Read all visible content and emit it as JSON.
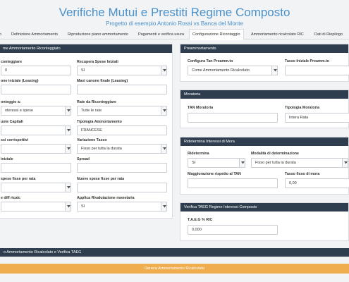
{
  "header": {
    "title": "Verifiche Mutui e Prestiti Regime Composto",
    "subtitle": "Progetto di esempio Antonio Rossi vs Banca del Monte"
  },
  "tabs": [
    {
      "label": "o"
    },
    {
      "label": "Definizione Ammortamento"
    },
    {
      "label": "Riproduzione piano ammortamento"
    },
    {
      "label": "Pagamenti e verifica usura"
    },
    {
      "label": "Configurazione Ricontaggio"
    },
    {
      "label": "Ammortamento ricalcolato RIC"
    },
    {
      "label": "Dati di Riepilogo"
    }
  ],
  "left_panel": {
    "title": "me Ammortamento Riconteggiato",
    "fields": {
      "ricont_label": "conteggiare",
      "ricont_value": "0",
      "recupera_label": "Recupera Spese Iniziali",
      "recupera_value": "SI",
      "canone_iniziale_label": "one iniziale (Leasing)",
      "maxi_canone_label": "Maxi canone finale (Leasing)",
      "ricont_a_label": "onteggio a:",
      "ricont_a_value": "nteressi e spese",
      "rate_ricont_label": "Rate da Riconteggiare",
      "rate_ricont_value": "Tutte le rate",
      "quote_capitali_label": "uote Capitali",
      "tipologia_amm_label": "Tipologia Ammortamento",
      "tipologia_amm_value": "FRANCESE",
      "tassi_label": "ssi corrispettivi",
      "variazione_label": "Variazione Tasso",
      "variazione_value": "Fisso per tutta la durata",
      "iniziale_label": "iniziale",
      "spread_label": "Spread",
      "spese_rata_label": "spese fisse per rata",
      "nuove_spese_label": "Nuove spese fisse per rata",
      "diff_label": "e diff ricalc",
      "rivalutazione_label": "Applica Rivalutazione monetaria",
      "rivalutazione_value": "SI"
    }
  },
  "preammortamento": {
    "title": "Preammortamento",
    "config_label": "Configura Tan Preamm.to",
    "config_value": "Come Ammortamento Ricalcolato",
    "tasso_label": "Tasso Iniziale Preamm.to"
  },
  "moratoria": {
    "title": "Moratoria",
    "tan_label": "TAN Moratoria",
    "tipologia_label": "Tipologia Moratoria",
    "tipologia_value": "Intera Rata"
  },
  "ridetermina": {
    "title": "Ridetermina Interessi di Mora",
    "ridetermina_label": "Ridetermina",
    "ridetermina_value": "SI",
    "modalita_label": "Modalità di determinazione",
    "modalita_value": "Fisso per tutta la durata",
    "maggiorazione_label": "Maggiorazione rispetto al TAN",
    "tasso_mora_label": "Tasso fisso di mora",
    "tasso_mora_value": "0,00"
  },
  "taeg": {
    "title": "Verifica TAEG Regime Interessi Composto",
    "label": "T.A.E.G % RIC",
    "value": "0,000"
  },
  "bottom": {
    "bar_label": "o Ammortamento Ricalcolato e Verifica TAEG",
    "button_label": "Genera Ammortamento Ricalcolato"
  }
}
